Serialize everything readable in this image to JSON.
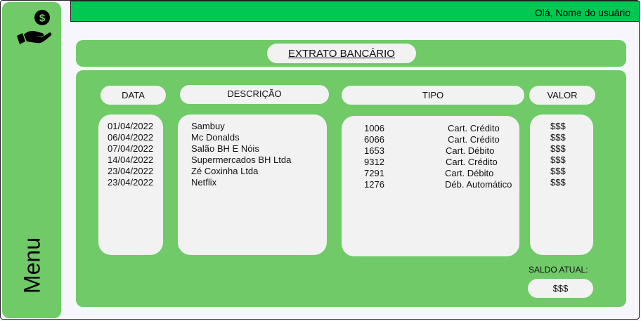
{
  "sidebar": {
    "logo_icon": "hand-coin-dollar-icon",
    "menu_label": "Menu"
  },
  "topbar": {
    "greeting": "Olá, Nome do usuário",
    "color": "#00c853"
  },
  "page": {
    "title": "EXTRATO BANCÁRIO",
    "accent_color": "#6fca67"
  },
  "columns": {
    "date": "DATA",
    "description": "DESCRIÇÃO",
    "type": "TIPO",
    "value": "VALOR"
  },
  "transactions": [
    {
      "date": "01/04/2022",
      "description": "Sambuy",
      "code": "1006",
      "type": "Cart. Crédito",
      "value": "$$$"
    },
    {
      "date": "06/04/2022",
      "description": "Mc Donalds",
      "code": "6066",
      "type": "Cart. Crédito",
      "value": "$$$"
    },
    {
      "date": "07/04/2022",
      "description": "Salão BH E Nóis",
      "code": "1653",
      "type": "Cart. Débito",
      "value": "$$$"
    },
    {
      "date": "14/04/2022",
      "description": "Supermercados BH Ltda",
      "code": "9312",
      "type": "Cart. Crédito",
      "value": "$$$"
    },
    {
      "date": "23/04/2022",
      "description": "Zé Coxinha Ltda",
      "code": "7291",
      "type": "Cart. Débito",
      "value": "$$$"
    },
    {
      "date": "23/04/2022",
      "description": "Netflix",
      "code": "1276",
      "type": "Déb. Automático",
      "value": "$$$"
    }
  ],
  "balance": {
    "label": "SALDO ATUAL:",
    "value": "$$$"
  }
}
